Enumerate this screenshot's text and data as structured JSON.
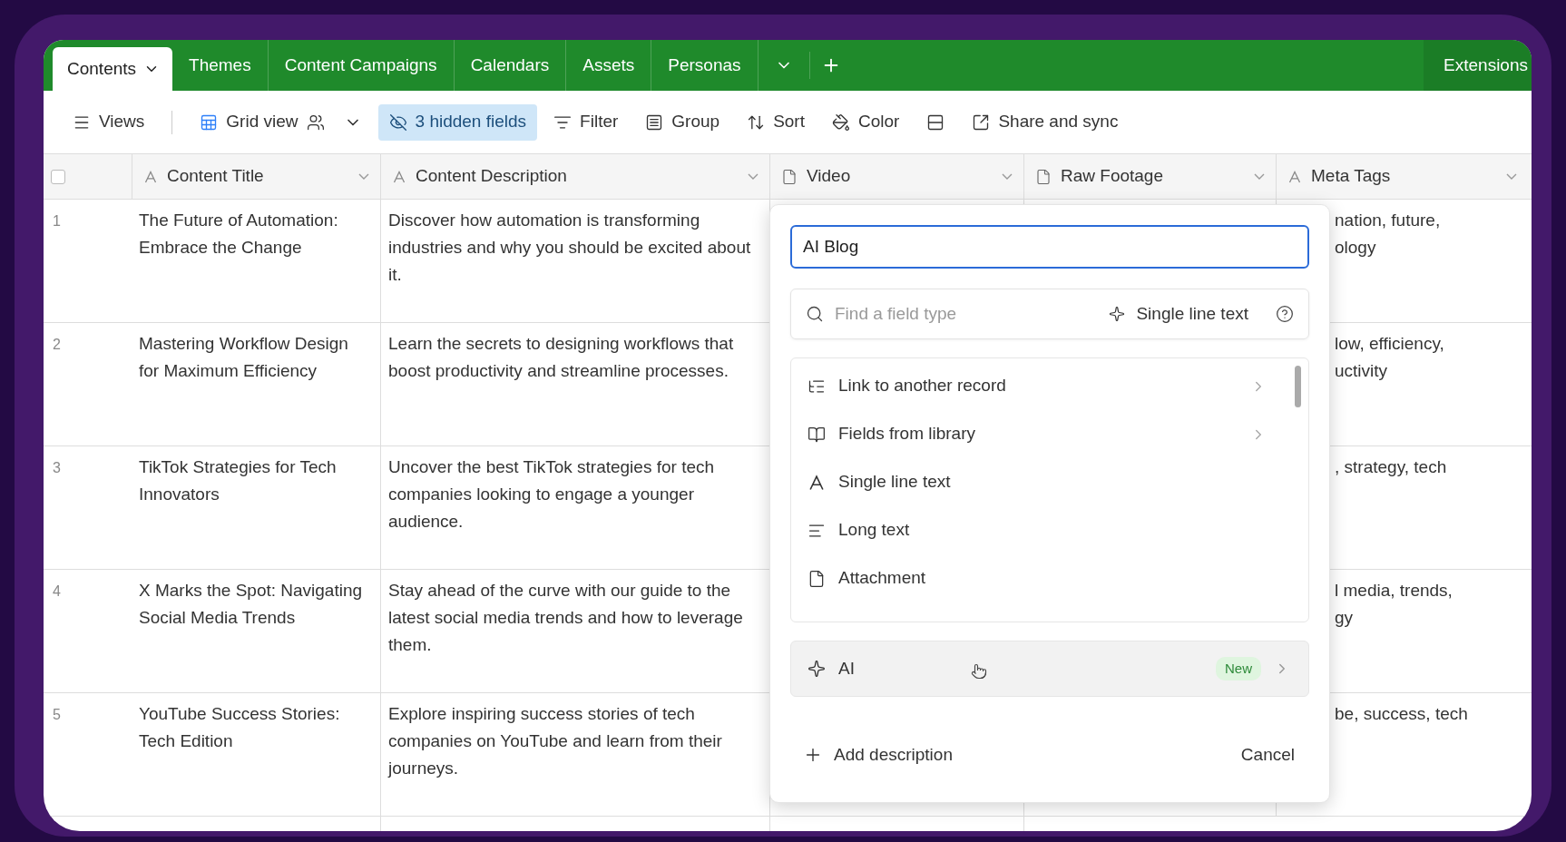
{
  "tabs": [
    {
      "label": "Contents",
      "selected": true
    },
    {
      "label": "Themes",
      "selected": false
    },
    {
      "label": "Content Campaigns",
      "selected": false
    },
    {
      "label": "Calendars",
      "selected": false
    },
    {
      "label": "Assets",
      "selected": false
    },
    {
      "label": "Personas",
      "selected": false
    }
  ],
  "extensions": "Extensions",
  "toolbar": [
    {
      "kind": "views",
      "label": "Views",
      "active": false
    },
    {
      "kind": "grid",
      "label": "Grid view",
      "active": false
    },
    {
      "kind": "hidden",
      "label": "3 hidden fields",
      "active": true
    },
    {
      "kind": "filter",
      "label": "Filter",
      "active": false
    },
    {
      "kind": "group",
      "label": "Group",
      "active": false
    },
    {
      "kind": "sort",
      "label": "Sort",
      "active": false
    },
    {
      "kind": "color",
      "label": "Color",
      "active": false
    },
    {
      "kind": "rowheight",
      "active": false
    },
    {
      "kind": "share",
      "label": "Share and sync",
      "active": false
    }
  ],
  "select_all": {
    "checked": false
  },
  "columns": [
    {
      "label": "Content Title",
      "kind": "text"
    },
    {
      "label": "Content Description",
      "kind": "text"
    },
    {
      "label": "Video",
      "kind": "attachment"
    },
    {
      "label": "Raw Footage",
      "kind": "attachment"
    },
    {
      "label": "Meta Tags",
      "kind": "text"
    }
  ],
  "rows": [
    {
      "number": "1",
      "title": "The Future of Automation: Embrace the Change",
      "description": "Discover how automation is transforming industries and why you should be excited about it.",
      "meta_tags": [
        "nation, future,",
        "ology"
      ]
    },
    {
      "number": "2",
      "title": "Mastering Workflow Design for Maximum Efficiency",
      "description": "Learn the secrets to designing workflows that boost productivity and streamline processes.",
      "meta_tags": [
        "low, efficiency,",
        "uctivity"
      ]
    },
    {
      "number": "3",
      "title": "TikTok Strategies for Tech Innovators",
      "description": "Uncover the best TikTok strategies for tech companies looking to engage a younger audience.",
      "meta_tags": [
        ", strategy, tech"
      ]
    },
    {
      "number": "4",
      "title": "X Marks the Spot: Navigating Social Media Trends",
      "description": "Stay ahead of the curve with our guide to the latest social media trends and how to leverage them.",
      "meta_tags": [
        "l media, trends,",
        "gy"
      ]
    },
    {
      "number": "5",
      "title": "YouTube Success Stories: Tech Edition",
      "description": "Explore inspiring success stories of tech companies on YouTube and learn from their journeys.",
      "meta_tags": [
        "be, success, tech"
      ]
    }
  ],
  "field_editor": {
    "name": {
      "value": "AI Blog"
    },
    "search": {
      "placeholder": "Find a field type"
    },
    "current_type": "Single line text",
    "types": [
      {
        "kind": "link",
        "label": "Link to another record",
        "submenu": true
      },
      {
        "kind": "library",
        "label": "Fields from library",
        "submenu": true
      },
      {
        "kind": "text",
        "label": "Single line text",
        "submenu": false
      },
      {
        "kind": "longtext",
        "label": "Long text",
        "submenu": false
      },
      {
        "kind": "attachment",
        "label": "Attachment",
        "submenu": false
      }
    ],
    "ai": {
      "label": "AI",
      "badge": "New"
    },
    "add_description": "Add description",
    "cancel": "Cancel"
  }
}
